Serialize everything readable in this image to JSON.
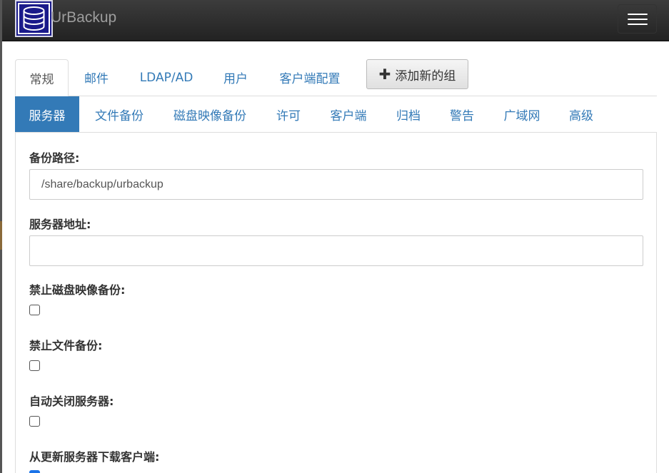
{
  "app": {
    "brand": "UrBackup",
    "logo_icon": "database-icon",
    "menu_icon": "hamburger-menu-icon"
  },
  "main_tabs": [
    {
      "label": "常规",
      "active": true
    },
    {
      "label": "邮件",
      "active": false
    },
    {
      "label": "LDAP/AD",
      "active": false
    },
    {
      "label": "用户",
      "active": false
    },
    {
      "label": "客户端配置",
      "active": false
    }
  ],
  "add_group_button": {
    "label": "添加新的组",
    "icon": "plus-icon"
  },
  "sub_tabs": [
    {
      "label": "服务器",
      "active": true
    },
    {
      "label": "文件备份",
      "active": false
    },
    {
      "label": "磁盘映像备份",
      "active": false
    },
    {
      "label": "许可",
      "active": false
    },
    {
      "label": "客户端",
      "active": false
    },
    {
      "label": "归档",
      "active": false
    },
    {
      "label": "警告",
      "active": false
    },
    {
      "label": "广域网",
      "active": false
    },
    {
      "label": "高级",
      "active": false
    }
  ],
  "form": {
    "backup_path": {
      "label": "备份路径:",
      "value": "/share/backup/urbackup"
    },
    "server_address": {
      "label": "服务器地址:",
      "value": ""
    },
    "disable_image_backup": {
      "label": "禁止磁盘映像备份:",
      "checked": false
    },
    "disable_file_backup": {
      "label": "禁止文件备份:",
      "checked": false
    },
    "auto_shutdown_server": {
      "label": "自动关闭服务器:",
      "checked": false
    },
    "download_client_from_update_server": {
      "label": "从更新服务器下载客户端:",
      "checked": true
    }
  },
  "colors": {
    "navbar": "#222222",
    "accent": "#337ab7",
    "link": "#337ab7",
    "checkbox_checked": "#1a73e8"
  }
}
